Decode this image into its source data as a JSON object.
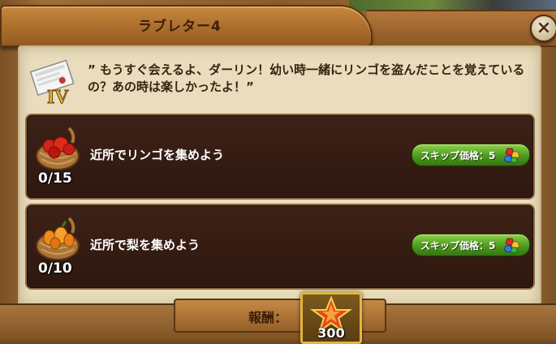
{
  "dialog": {
    "title": "ラブレター4",
    "close_label": "×",
    "chapter_numeral": "IV",
    "story_text": "” もうすぐ会えるよ、ダーリン！幼い時一緒にリンゴを盗んだことを覚えているの？あの時は楽しかったよ！”"
  },
  "tasks": [
    {
      "label": "近所でリンゴを集めよう",
      "progress": "0/15",
      "skip_label": "スキップ価格：5",
      "icon": "apple-basket-icon"
    },
    {
      "label": "近所で梨を集めよう",
      "progress": "0/10",
      "skip_label": "スキップ価格：5",
      "icon": "pear-basket-icon"
    }
  ],
  "reward": {
    "label": "報酬：",
    "amount": "300",
    "icon": "star-icon"
  },
  "colors": {
    "wood": "#a06d36",
    "parchment": "#e9ddbe",
    "task_bg": "#3d2116",
    "button_green": "#4d9a1c",
    "reward_border": "#e2b53e"
  }
}
